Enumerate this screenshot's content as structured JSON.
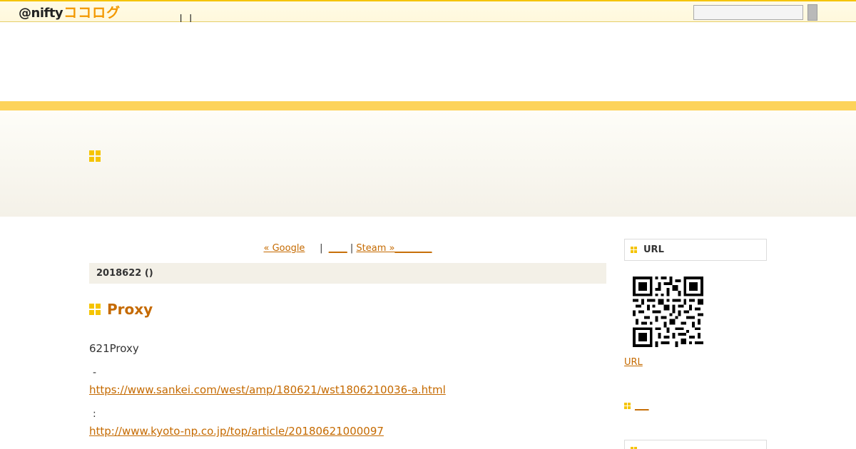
{
  "topbar": {
    "logo_text": "@nifty",
    "logo_brand": "ココログ",
    "links": " |  | __",
    "search_placeholder": ""
  },
  "entry_nav": {
    "prev": "« Google",
    "sep1": "     |  ",
    "home": "____",
    "sep2": " | ",
    "next": "Steam »",
    "trailing": "________"
  },
  "post": {
    "date": "2018622 ()",
    "title": "Proxy",
    "intro": "621Proxy",
    "source1_label": " -",
    "link1": "https://www.sankei.com/west/amp/180621/wst1806210036-a.html",
    "source2_label": " :",
    "link2": "http://www.kyoto-np.co.jp/top/article/20180621000097"
  },
  "sidebar": {
    "qr_heading": "URL",
    "qr_link": "URL",
    "item_link": "___"
  },
  "colors": {
    "accent": "#f5c400",
    "stripe": "#fdd35a",
    "link": "#c56a00",
    "date_bar": "#f3f0e7"
  },
  "icons": [
    "square-grid-icon",
    "qr-code-icon"
  ]
}
